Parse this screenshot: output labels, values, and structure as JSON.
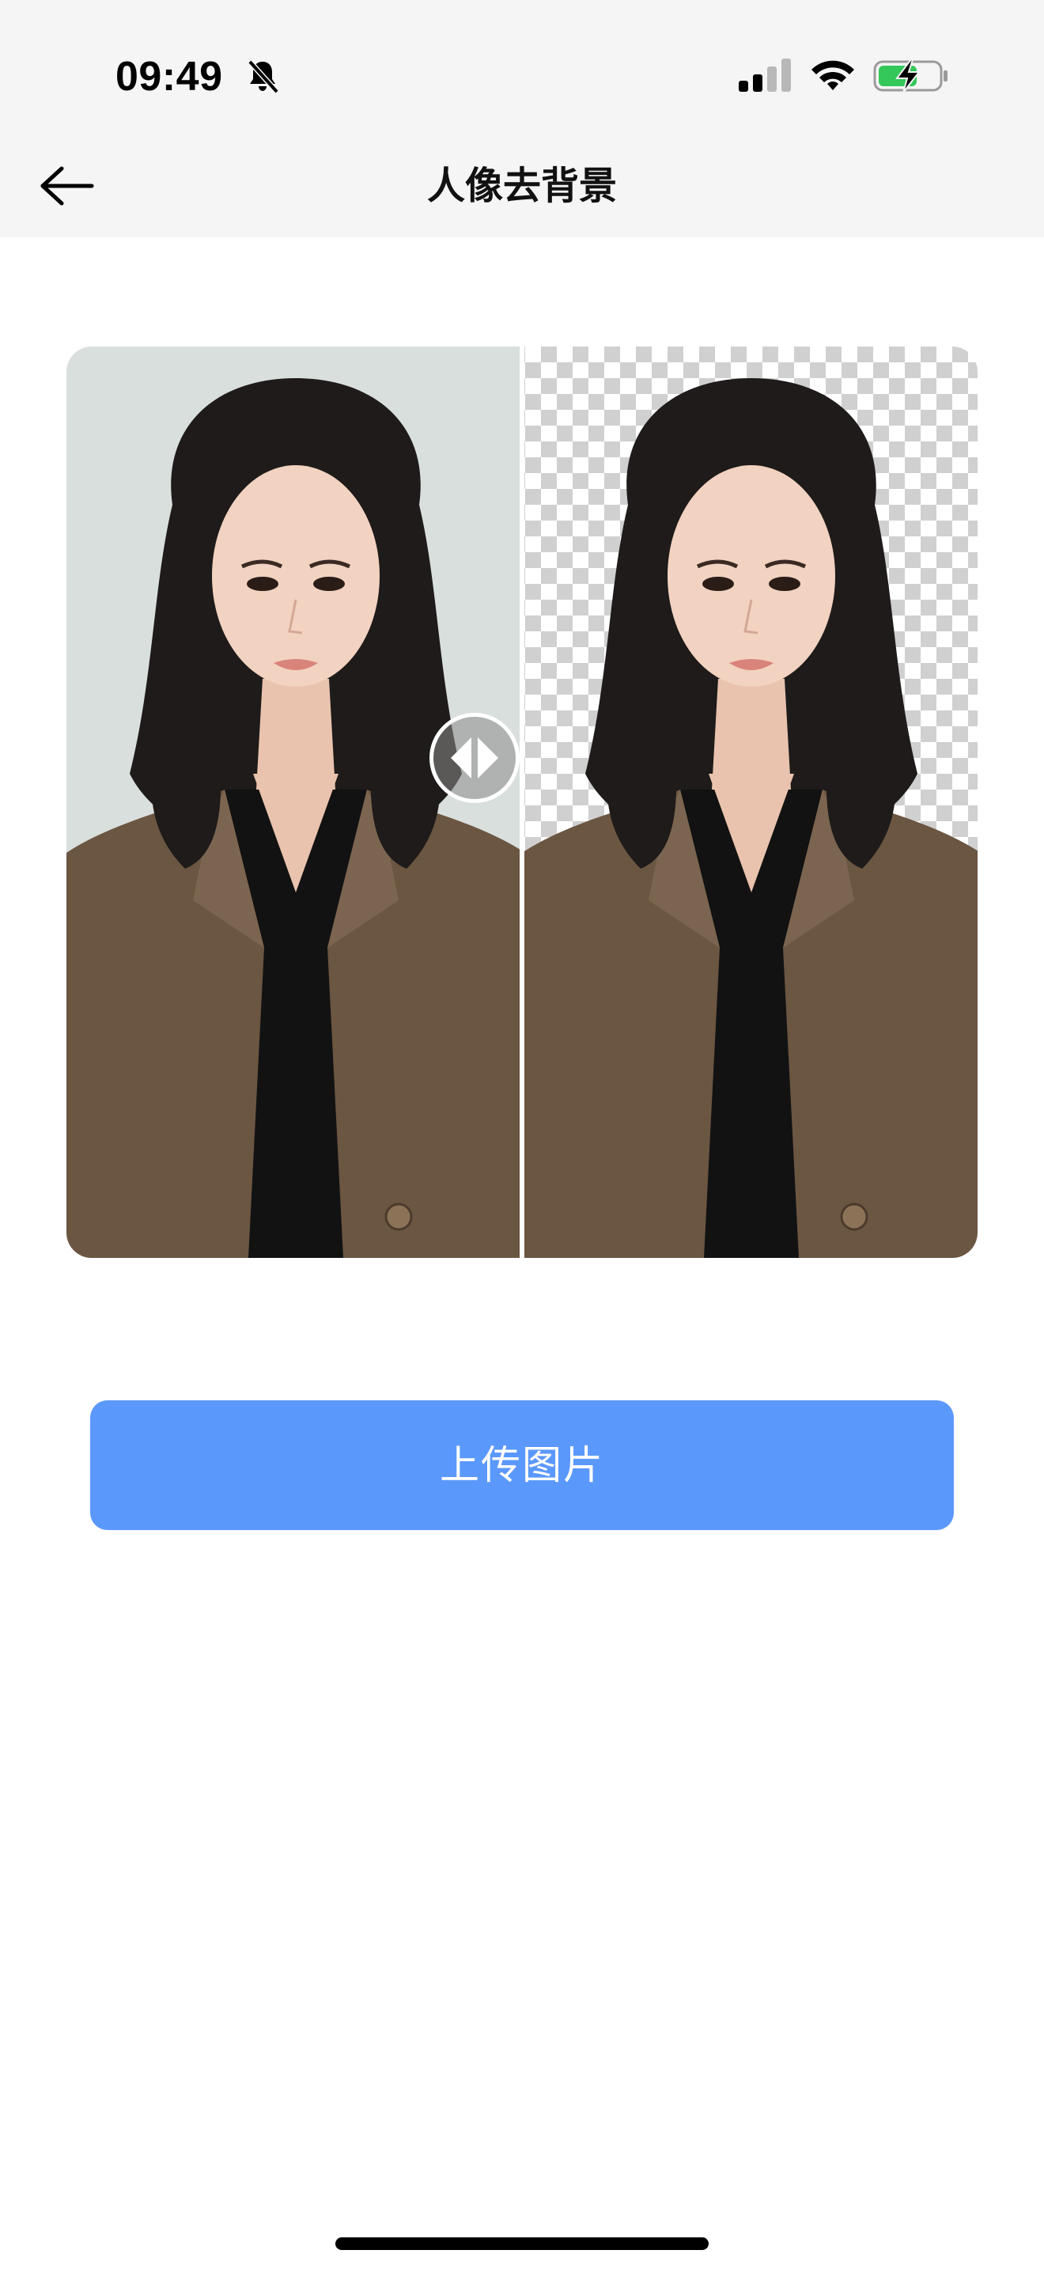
{
  "status_bar": {
    "time": "09:49",
    "icons": [
      "bell-slash-icon",
      "cellular-signal-icon",
      "wifi-icon",
      "battery-charging-icon"
    ],
    "battery_color": "#34c759"
  },
  "nav": {
    "back_icon": "arrow-left-icon",
    "title": "人像去背景"
  },
  "preview": {
    "left_image": "portrait-original",
    "right_image": "portrait-background-removed",
    "handle_icon": "split-compare-handle-icon"
  },
  "upload_button": {
    "label": "上传图片",
    "color": "#5b98fb"
  },
  "colors": {
    "header_bg": "#f5f5f5",
    "original_bg": "#d9dfdd",
    "jacket": "#6b5642",
    "hair": "#1e1b1a"
  }
}
